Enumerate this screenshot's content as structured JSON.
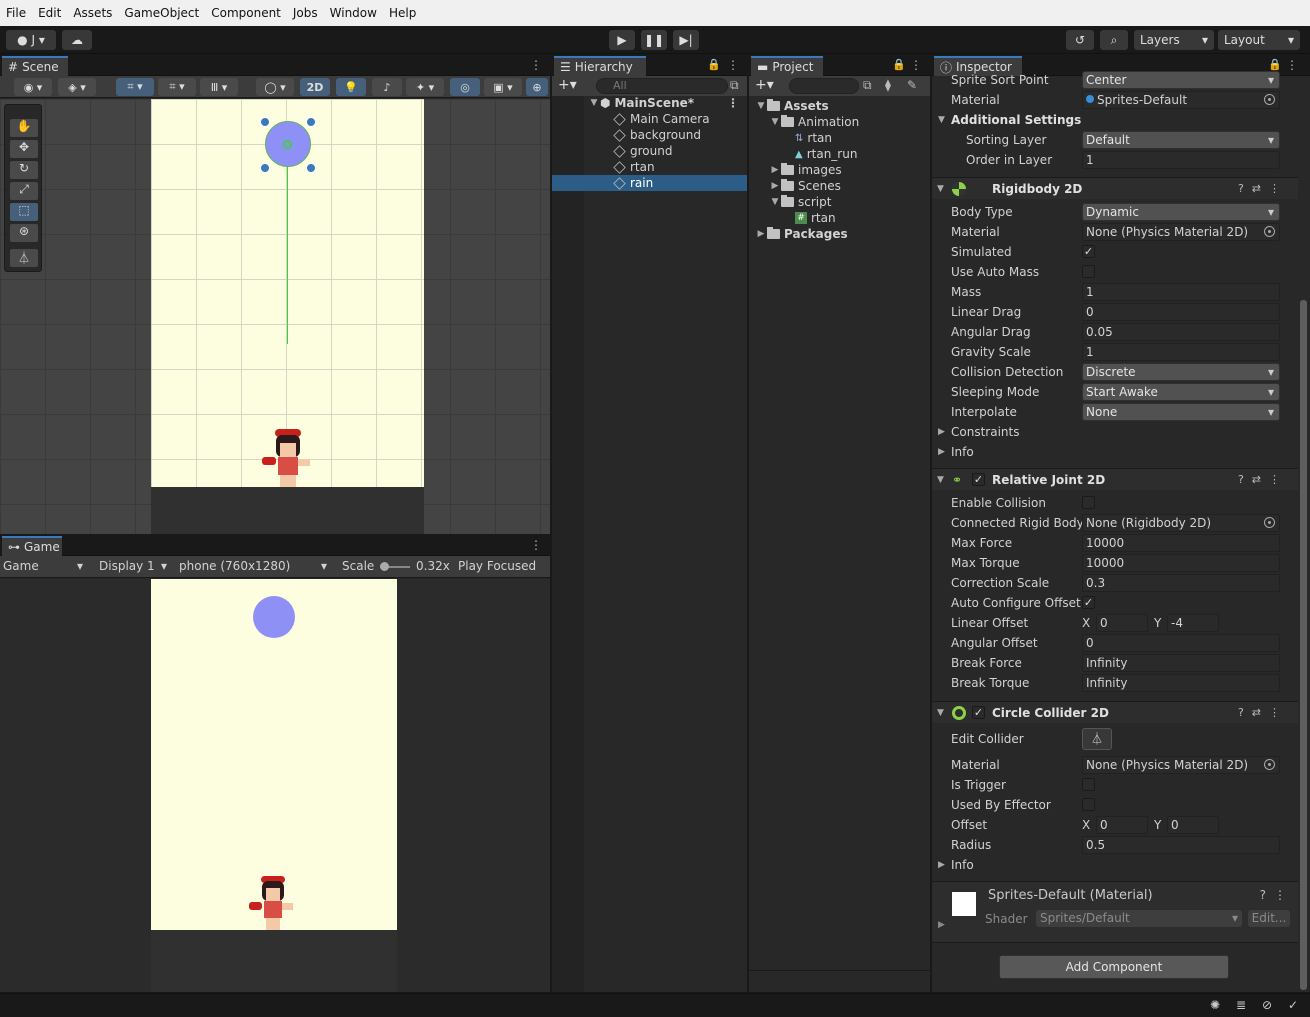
{
  "menu": [
    "File",
    "Edit",
    "Assets",
    "GameObject",
    "Component",
    "Jobs",
    "Window",
    "Help"
  ],
  "toolbar": {
    "account": "J",
    "layers": "Layers",
    "layout": "Layout"
  },
  "scene": {
    "tab": "Scene",
    "mode_2d": "2D"
  },
  "game": {
    "tab": "Game",
    "view": "Game",
    "display": "Display 1",
    "resolution": "phone (760x1280)",
    "scale_label": "Scale",
    "scale_value": "0.32x",
    "play_mode": "Play Focused"
  },
  "hierarchy": {
    "tab": "Hierarchy",
    "search_placeholder": "All",
    "scene": "MainScene*",
    "items": [
      "Main Camera",
      "background",
      "ground",
      "rtan",
      "rain"
    ],
    "selected": "rain"
  },
  "project": {
    "tab": "Project",
    "tree": [
      {
        "label": "Assets",
        "depth": 0,
        "type": "folder",
        "open": true,
        "bold": true
      },
      {
        "label": "Animation",
        "depth": 1,
        "type": "folder",
        "open": true
      },
      {
        "label": "rtan",
        "depth": 2,
        "type": "anim-controller"
      },
      {
        "label": "rtan_run",
        "depth": 2,
        "type": "anim-clip"
      },
      {
        "label": "images",
        "depth": 1,
        "type": "folder",
        "open": false
      },
      {
        "label": "Scenes",
        "depth": 1,
        "type": "folder",
        "open": false
      },
      {
        "label": "script",
        "depth": 1,
        "type": "folder",
        "open": true
      },
      {
        "label": "rtan",
        "depth": 2,
        "type": "script"
      },
      {
        "label": "Packages",
        "depth": 0,
        "type": "folder",
        "open": false,
        "bold": true
      }
    ]
  },
  "inspector": {
    "tab": "Inspector",
    "sprite_renderer": {
      "sort_point_label": "Sprite Sort Point",
      "sort_point": "Center",
      "material_label": "Material",
      "material": "Sprites-Default",
      "additional_settings": "Additional Settings",
      "sorting_layer_label": "Sorting Layer",
      "sorting_layer": "Default",
      "order_label": "Order in Layer",
      "order": "1"
    },
    "rigidbody": {
      "title": "Rigidbody 2D",
      "rows": [
        {
          "label": "Body Type",
          "value": "Dynamic",
          "kind": "drop"
        },
        {
          "label": "Material",
          "value": "None (Physics Material 2D)",
          "kind": "obj"
        },
        {
          "label": "Simulated",
          "value": "✓",
          "kind": "chk"
        },
        {
          "label": "Use Auto Mass",
          "value": "",
          "kind": "chk"
        },
        {
          "label": "Mass",
          "value": "1",
          "kind": "field"
        },
        {
          "label": "Linear Drag",
          "value": "0",
          "kind": "field"
        },
        {
          "label": "Angular Drag",
          "value": "0.05",
          "kind": "field"
        },
        {
          "label": "Gravity Scale",
          "value": "1",
          "kind": "field"
        },
        {
          "label": "Collision Detection",
          "value": "Discrete",
          "kind": "drop"
        },
        {
          "label": "Sleeping Mode",
          "value": "Start Awake",
          "kind": "drop"
        },
        {
          "label": "Interpolate",
          "value": "None",
          "kind": "drop"
        }
      ],
      "constraints": "Constraints",
      "info": "Info"
    },
    "relative_joint": {
      "title": "Relative Joint 2D",
      "rows": [
        {
          "label": "Enable Collision",
          "value": "",
          "kind": "chk"
        },
        {
          "label": "Connected Rigid Body",
          "value": "None (Rigidbody 2D)",
          "kind": "obj"
        },
        {
          "label": "Max Force",
          "value": "10000",
          "kind": "field"
        },
        {
          "label": "Max Torque",
          "value": "10000",
          "kind": "field"
        },
        {
          "label": "Correction Scale",
          "value": "0.3",
          "kind": "field"
        },
        {
          "label": "Auto Configure Offset",
          "value": "✓",
          "kind": "chk"
        },
        {
          "label": "Linear Offset",
          "x": "0",
          "y": "-4",
          "kind": "xy"
        },
        {
          "label": "Angular Offset",
          "value": "0",
          "kind": "field"
        },
        {
          "label": "Break Force",
          "value": "Infinity",
          "kind": "field"
        },
        {
          "label": "Break Torque",
          "value": "Infinity",
          "kind": "field"
        }
      ]
    },
    "circle_collider": {
      "title": "Circle Collider 2D",
      "edit_collider": "Edit Collider",
      "rows": [
        {
          "label": "Material",
          "value": "None (Physics Material 2D)",
          "kind": "obj"
        },
        {
          "label": "Is Trigger",
          "value": "",
          "kind": "chk"
        },
        {
          "label": "Used By Effector",
          "value": "",
          "kind": "chk"
        },
        {
          "label": "Offset",
          "x": "0",
          "y": "0",
          "kind": "xy"
        },
        {
          "label": "Radius",
          "value": "0.5",
          "kind": "field"
        }
      ],
      "info": "Info"
    },
    "material_section": {
      "name": "Sprites-Default (Material)",
      "shader_label": "Shader",
      "shader": "Sprites/Default",
      "edit": "Edit..."
    },
    "add_component": "Add Component",
    "x_label": "X",
    "y_label": "Y"
  }
}
